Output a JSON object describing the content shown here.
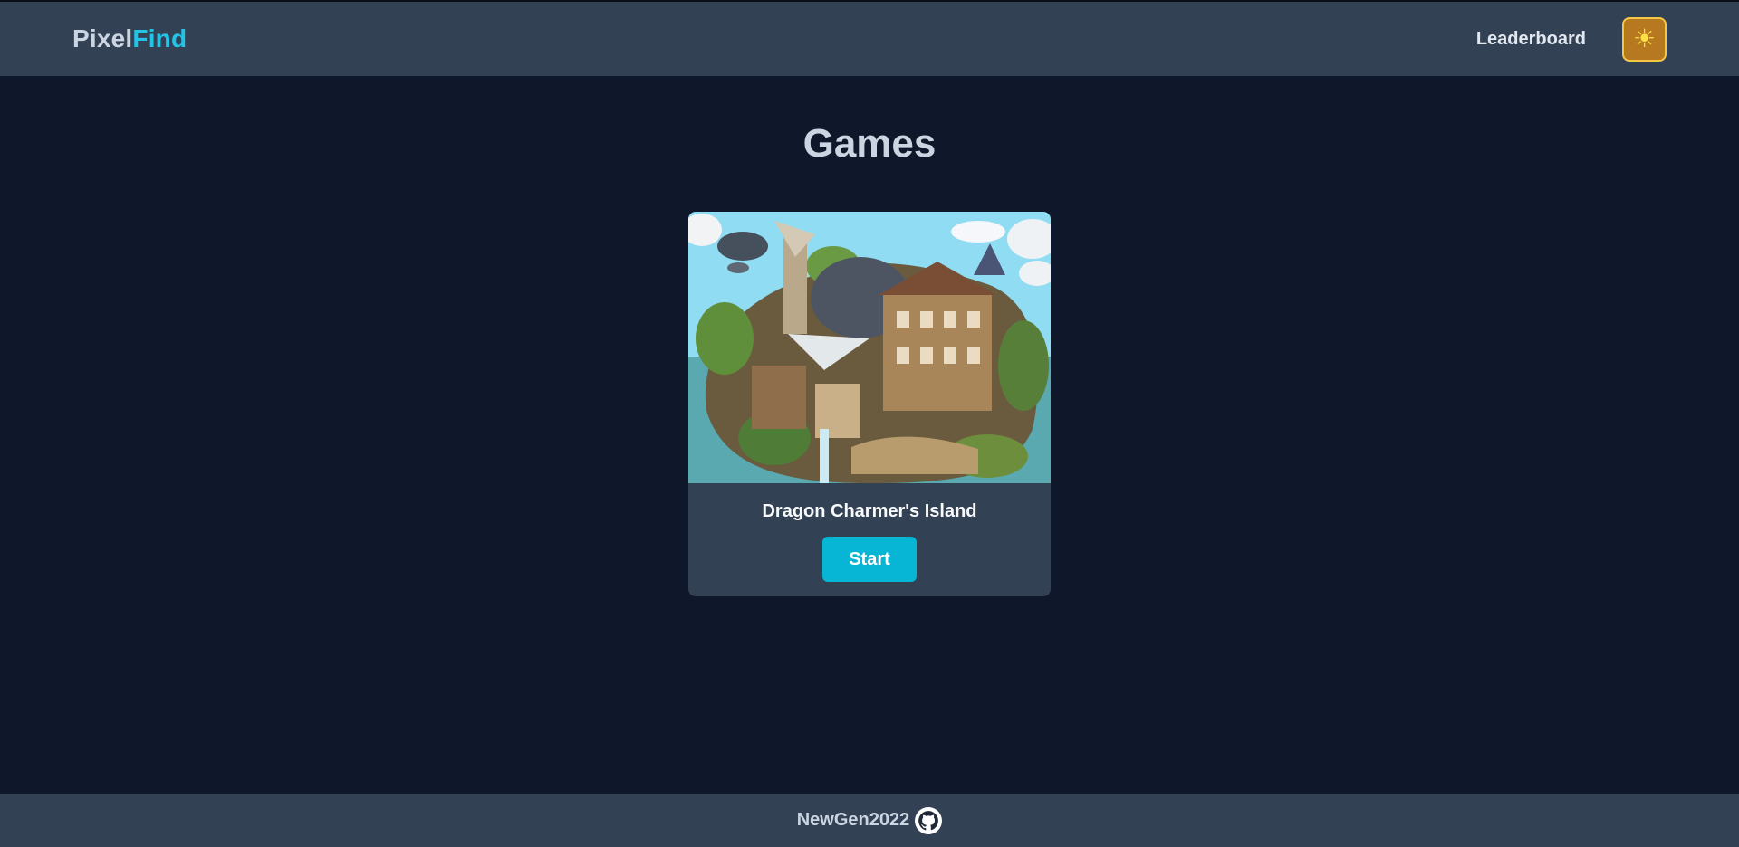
{
  "header": {
    "logo_part1": "Pixel",
    "logo_part2": "Find",
    "leaderboard_label": "Leaderboard",
    "theme_icon": "sun-icon"
  },
  "main": {
    "title": "Games",
    "games": [
      {
        "name": "Dragon Charmer's Island",
        "start_label": "Start",
        "image": "island-illustration"
      }
    ]
  },
  "footer": {
    "author": "NewGen2022",
    "icon": "github-icon"
  },
  "colors": {
    "background": "#0f172a",
    "bar": "#334155",
    "accent": "#06b6d4",
    "logo_accent": "#22c3e6",
    "theme_button": "#b7791f"
  }
}
